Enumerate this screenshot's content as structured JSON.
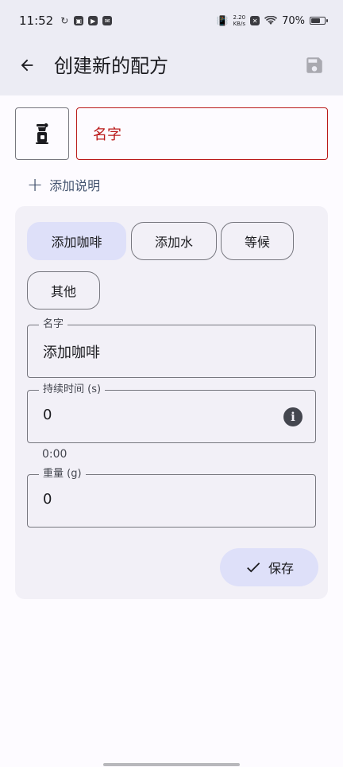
{
  "status_bar": {
    "time": "11:52",
    "net_speed_top": "2.20",
    "net_speed_bottom": "KB/s",
    "battery_percent": "70%",
    "battery_level": 0.7
  },
  "app_bar": {
    "title": "创建新的配方"
  },
  "recipe": {
    "name_placeholder": "名字",
    "add_description_label": "添加说明"
  },
  "step_types": [
    {
      "label": "添加咖啡",
      "selected": true
    },
    {
      "label": "添加水",
      "selected": false
    },
    {
      "label": "等候",
      "selected": false
    },
    {
      "label": "其他",
      "selected": false
    }
  ],
  "step_form": {
    "name_label": "名字",
    "name_value": "添加咖啡",
    "duration_label": "持续时间 (s)",
    "duration_value": "0",
    "duration_helper": "0:00",
    "weight_label": "重量 (g)",
    "weight_value": "0",
    "save_label": "保存"
  },
  "colors": {
    "accent_container": "#dee0f9",
    "error": "#ba1a1a",
    "surface_variant": "#f2f0f7"
  }
}
